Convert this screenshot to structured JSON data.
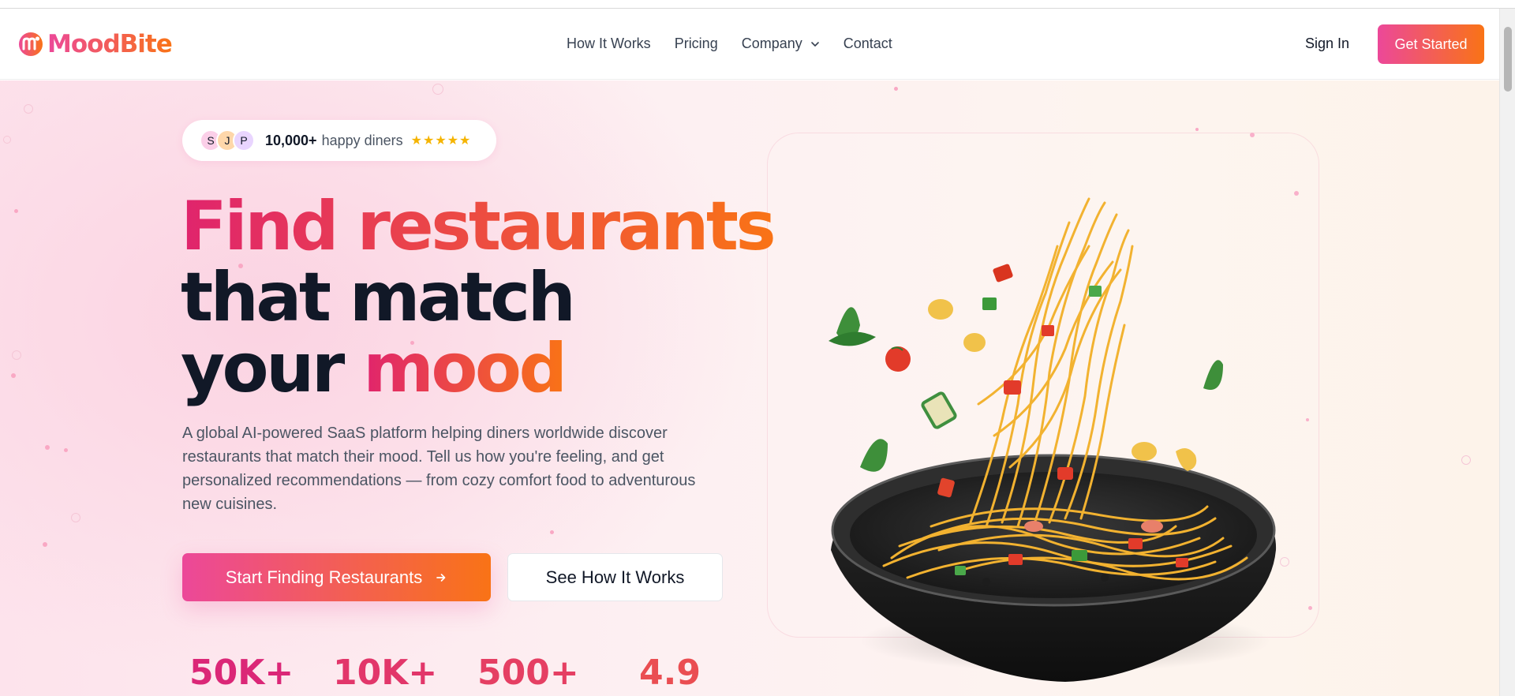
{
  "brand": {
    "name": "MoodBite",
    "logo_icon": "moodbite-logo-icon"
  },
  "nav": {
    "links": [
      {
        "label": "How It Works"
      },
      {
        "label": "Pricing"
      },
      {
        "label": "Company",
        "icon": "chevron-down-icon"
      },
      {
        "label": "Contact"
      }
    ],
    "signin": "Sign In",
    "cta": "Get Started"
  },
  "hero": {
    "badge": {
      "avatars": [
        "S",
        "J",
        "P"
      ],
      "count": "10,000+",
      "text": "happy diners",
      "stars": "★★★★★",
      "star_icon": "star-icon"
    },
    "headline": {
      "line1": "Find restaurants",
      "line2": "that match",
      "line3_plain": "your",
      "line3_accent": "mood"
    },
    "description": "A global AI-powered SaaS platform helping diners worldwide discover restaurants that match their mood. Tell us how you're feeling, and get personalized recommendations — from cozy comfort food to adventurous new cuisines.",
    "primary_button": "Start Finding Restaurants",
    "primary_icon": "arrow-right-icon",
    "secondary_button": "See How It Works",
    "stats": [
      "50K+",
      "10K+",
      "500+",
      "4.9"
    ],
    "image_icon": "pasta-pan-illustration"
  },
  "colors": {
    "brand_pink": "#ec4899",
    "brand_orange": "#f97316",
    "heading_dark": "#111827",
    "body_gray": "#4b5563"
  }
}
